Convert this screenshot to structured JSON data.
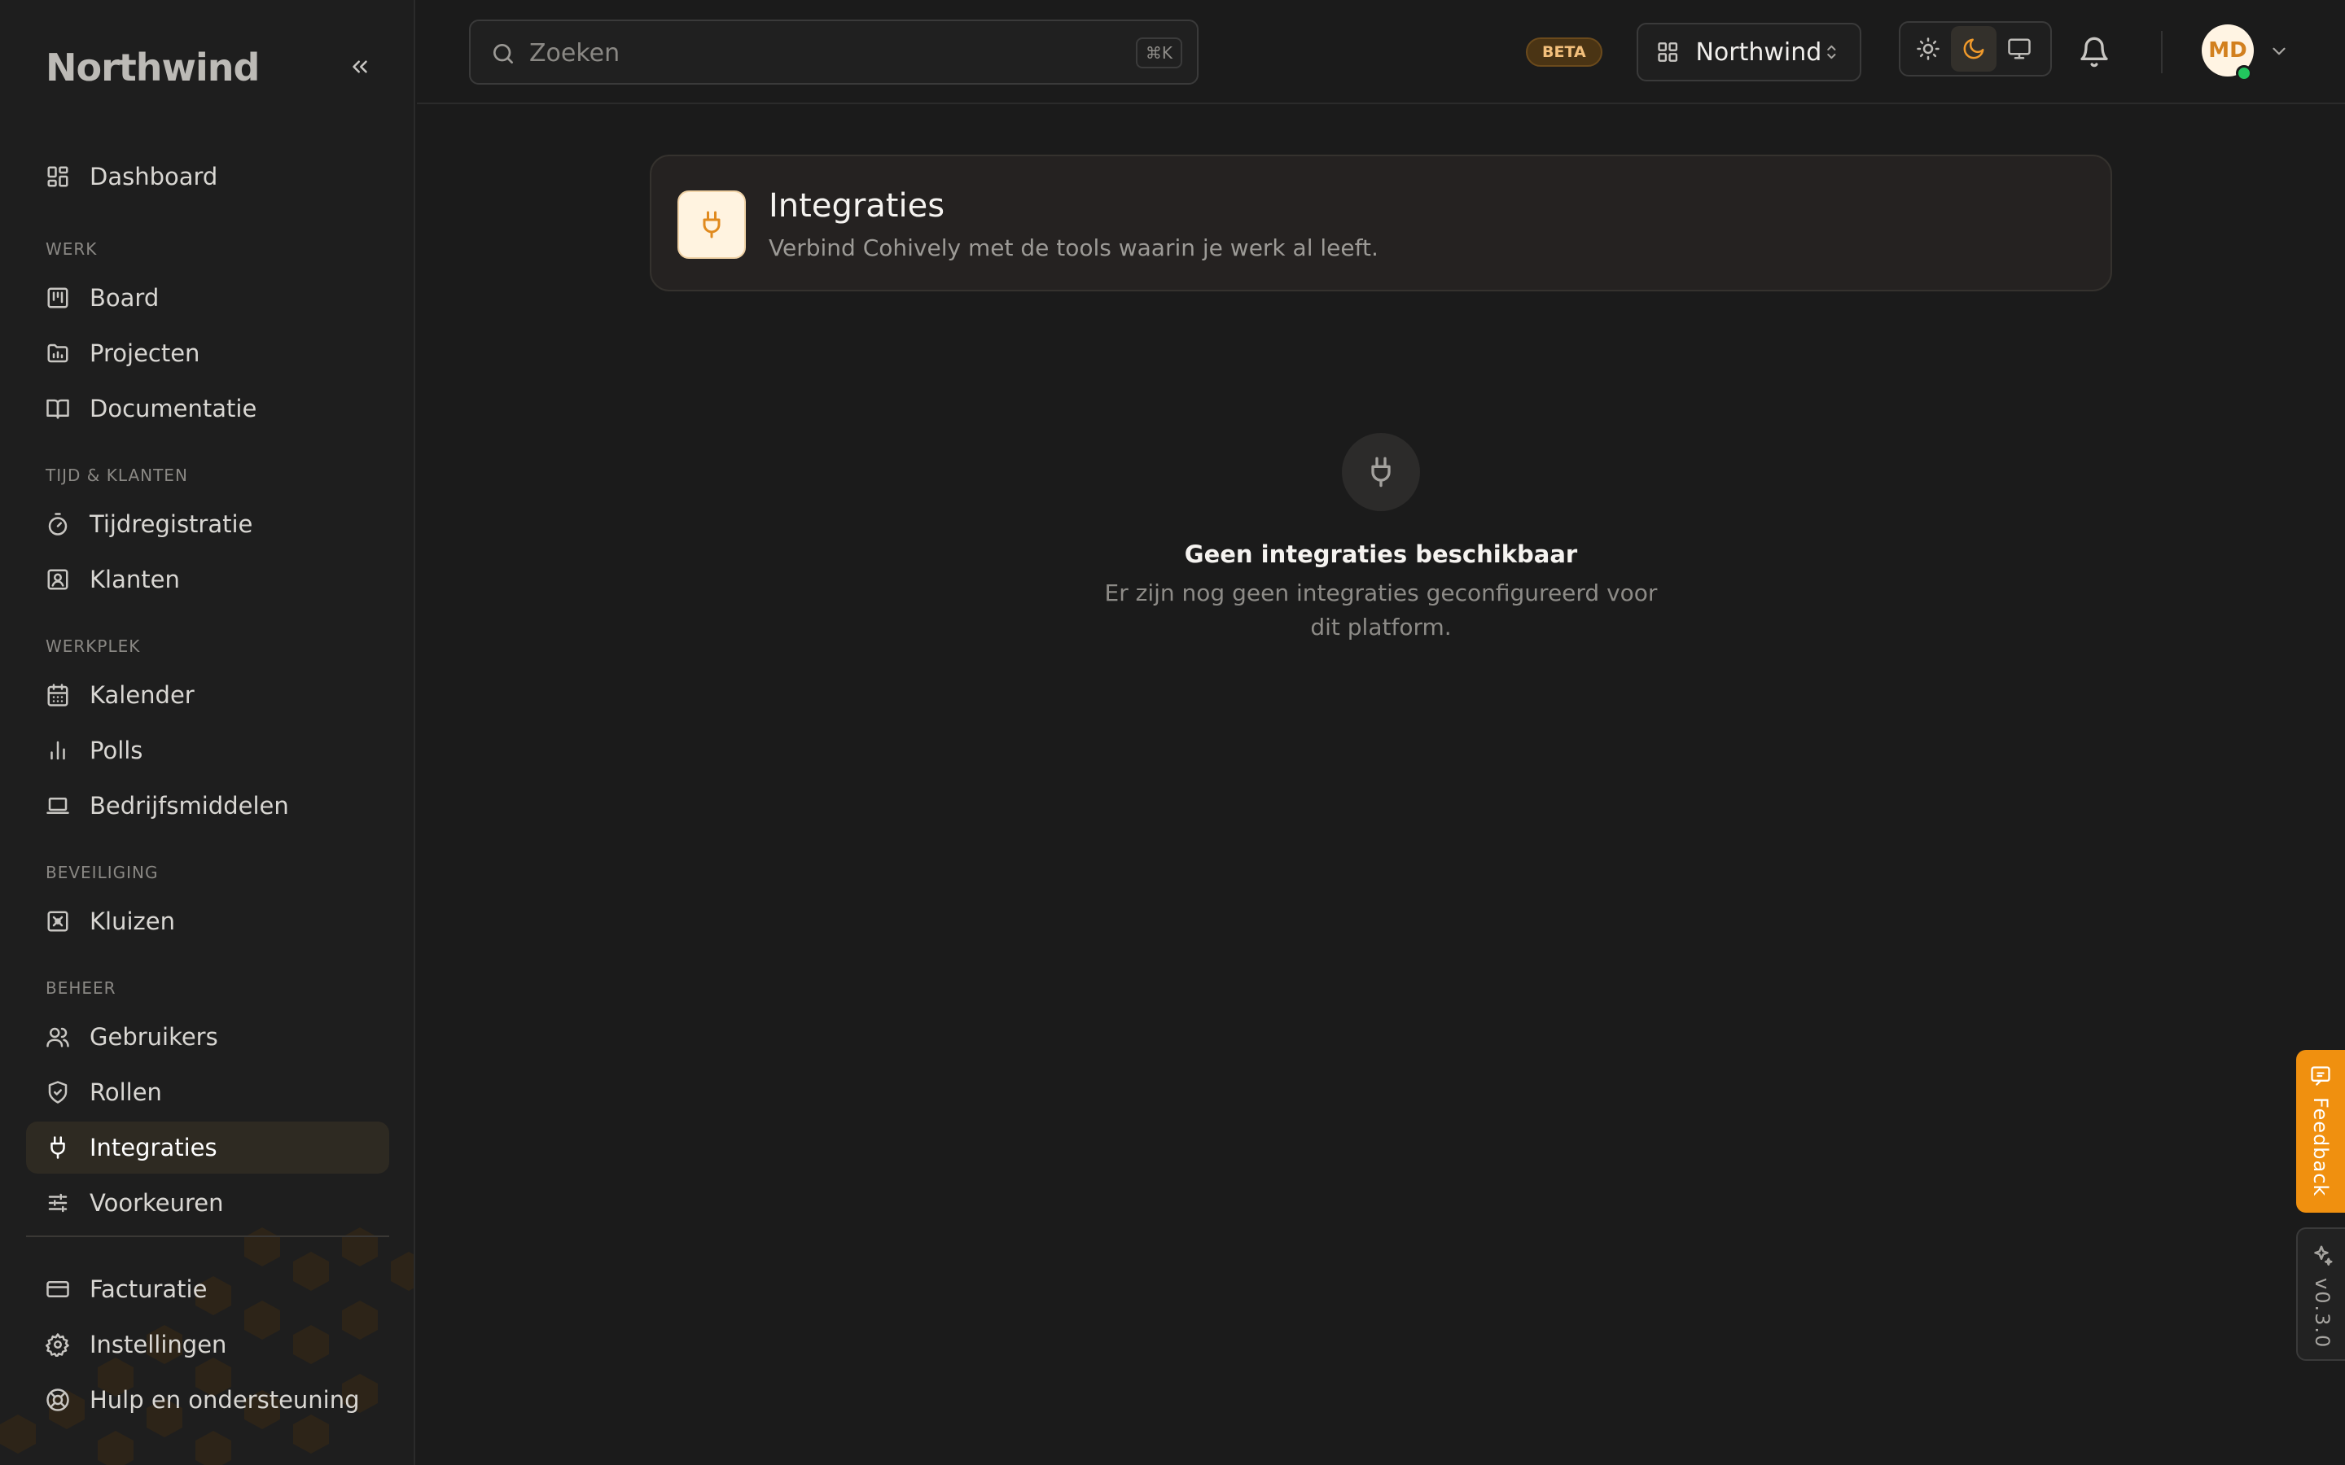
{
  "app": {
    "logo": "Northwind"
  },
  "sidebar": {
    "top_item": {
      "label": "Dashboard",
      "icon": "dashboard-icon"
    },
    "sections": [
      {
        "label": "WERK",
        "items": [
          {
            "label": "Board",
            "icon": "board-icon"
          },
          {
            "label": "Projecten",
            "icon": "folder-chart-icon"
          },
          {
            "label": "Documentatie",
            "icon": "book-icon"
          }
        ]
      },
      {
        "label": "TIJD & KLANTEN",
        "items": [
          {
            "label": "Tijdregistratie",
            "icon": "stopwatch-icon"
          },
          {
            "label": "Klanten",
            "icon": "contact-card-icon"
          }
        ]
      },
      {
        "label": "WERKPLEK",
        "items": [
          {
            "label": "Kalender",
            "icon": "calendar-icon"
          },
          {
            "label": "Polls",
            "icon": "bar-chart-icon"
          },
          {
            "label": "Bedrijfsmiddelen",
            "icon": "laptop-icon"
          }
        ]
      },
      {
        "label": "BEVEILIGING",
        "items": [
          {
            "label": "Kluizen",
            "icon": "vault-icon"
          }
        ]
      },
      {
        "label": "BEHEER",
        "items": [
          {
            "label": "Gebruikers",
            "icon": "users-icon"
          },
          {
            "label": "Rollen",
            "icon": "shield-check-icon"
          },
          {
            "label": "Integraties",
            "icon": "plug-icon",
            "active": true
          },
          {
            "label": "Voorkeuren",
            "icon": "sliders-icon"
          }
        ]
      }
    ],
    "bottom_items": [
      {
        "label": "Facturatie",
        "icon": "credit-card-icon"
      },
      {
        "label": "Instellingen",
        "icon": "gear-icon"
      },
      {
        "label": "Hulp en ondersteuning",
        "icon": "lifebuoy-icon"
      }
    ]
  },
  "topbar": {
    "search": {
      "placeholder": "Zoeken",
      "shortcut": "⌘K"
    },
    "beta_badge": "BETA",
    "workspace": {
      "label": "Northwind"
    },
    "theme": {
      "options": [
        "light",
        "dark",
        "system"
      ],
      "selected": "dark"
    },
    "user": {
      "initials": "MD",
      "status": "online"
    }
  },
  "page": {
    "title": "Integraties",
    "subtitle": "Verbind Cohively met de tools waarin je werk al leeft.",
    "empty_state": {
      "title": "Geen integraties beschikbaar",
      "description": "Er zijn nog geen integraties geconfigureerd voor dit platform."
    }
  },
  "side_tabs": {
    "feedback": "Feedback",
    "version": "v0.3.0"
  },
  "colors": {
    "accent": "#f0900f",
    "background": "#1b1b1b",
    "sidebar": "#1e1e1e",
    "active_item": "#2e2a22"
  }
}
